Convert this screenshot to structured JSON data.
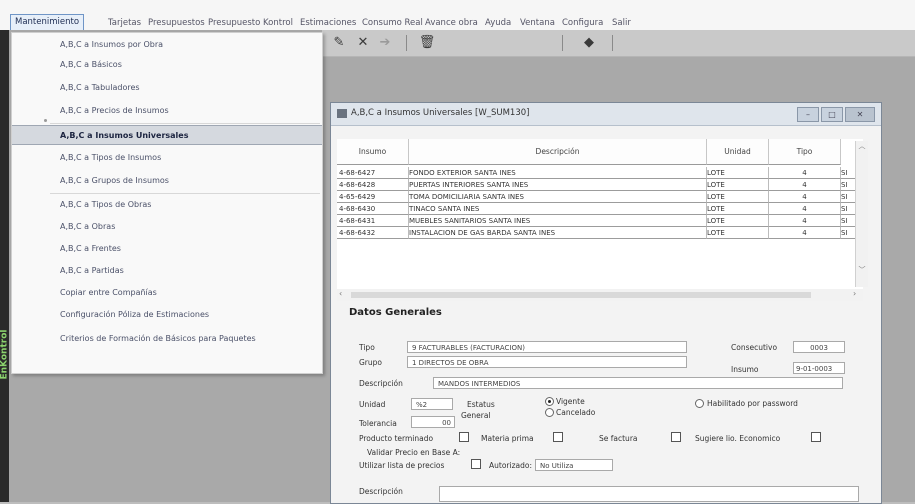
{
  "menu": [
    {
      "label": "Mantenimiento",
      "active": true
    },
    {
      "label": "Tarjetas"
    },
    {
      "label": "Presupuestos"
    },
    {
      "label": "Presupuesto Kontrol"
    },
    {
      "label": "Estimaciones"
    },
    {
      "label": "Consumo Real"
    },
    {
      "label": "Avance obra"
    },
    {
      "label": "Ayuda"
    },
    {
      "label": "Ventana"
    },
    {
      "label": "Configura"
    },
    {
      "label": "Salir"
    }
  ],
  "brand": "EnKontrol",
  "dropdown": [
    "A,B,C a Insumos por Obra",
    "A,B,C a Básicos",
    "A,B,C a Tabuladores",
    "A,B,C a Precios de Insumos",
    "A,B,C a Insumos Universales",
    "A,B,C a Tipos de Insumos",
    "A,B,C a Grupos de Insumos",
    "A,B,C a Tipos de Obras",
    "A,B,C a Obras",
    "A,B,C a Frentes",
    "A,B,C a Partidas",
    "Copiar entre Compañías",
    "Configuración Póliza de Estimaciones",
    "Criterios de Formación de Básicos para Paquetes"
  ],
  "window": {
    "title": "A,B,C a Insumos Universales [W_SUM130]",
    "grid": {
      "columns": [
        "Insumo",
        "Descripción",
        "Unidad",
        "Tipo"
      ],
      "rows": [
        {
          "insumo": "4-68-6427",
          "desc": "FONDO EXTERIOR SANTA INES",
          "unidad": "LOTE",
          "tipo": "4",
          "x": "SI"
        },
        {
          "insumo": "4-68-6428",
          "desc": "PUERTAS INTERIORES SANTA INES",
          "unidad": "LOTE",
          "tipo": "4",
          "x": "SI"
        },
        {
          "insumo": "4-65-6429",
          "desc": "TOMA DOMICILIARIA SANTA INES",
          "unidad": "LOTE",
          "tipo": "4",
          "x": "SI"
        },
        {
          "insumo": "4-68-6430",
          "desc": "TINACO SANTA INES",
          "unidad": "LOTE",
          "tipo": "4",
          "x": "SI"
        },
        {
          "insumo": "4-68-6431",
          "desc": "MUEBLES SANITARIOS SANTA INES",
          "unidad": "LOTE",
          "tipo": "4",
          "x": "SI"
        },
        {
          "insumo": "4-68-6432",
          "desc": "INSTALACION DE GAS BARDA SANTA INES",
          "unidad": "LOTE",
          "tipo": "4",
          "x": "SI"
        }
      ]
    },
    "form": {
      "section": "Datos Generales",
      "tipo_label": "Tipo",
      "tipo_value": "9  FACTURABLES (FACTURACION)",
      "grupo_label": "Grupo",
      "grupo_value": "1  DIRECTOS DE OBRA",
      "consecutivo_label": "Consecutivo",
      "consecutivo_value": "0003",
      "insumo_label": "Insumo",
      "insumo_value": "9-01-0003",
      "descripcion_label": "Descripción",
      "descripcion_value": "MANDOS INTERMEDIOS",
      "unidad_label": "Unidad",
      "unidad_value": "%2",
      "estatus_label": "Estatus",
      "general_label": "General",
      "vigente_label": "Vigente",
      "cancelado_label": "Cancelado",
      "habilitado_label": "Habilitado por password",
      "tolerancia_label": "Tolerancia",
      "tolerancia_value": "00",
      "producto_label": "Producto terminado",
      "materia_label": "Materia prima",
      "sefactura_label": "Se factura",
      "sugiere_label": "Sugiere lio. Economico",
      "validar_label": "Validar Precio en Base A:",
      "utilizar_label": "Utilizar lista de precios",
      "autorizado_label": "Autorizado:",
      "autorizado_value": "No Utiliza",
      "descripcion2_label": "Descripción"
    }
  }
}
